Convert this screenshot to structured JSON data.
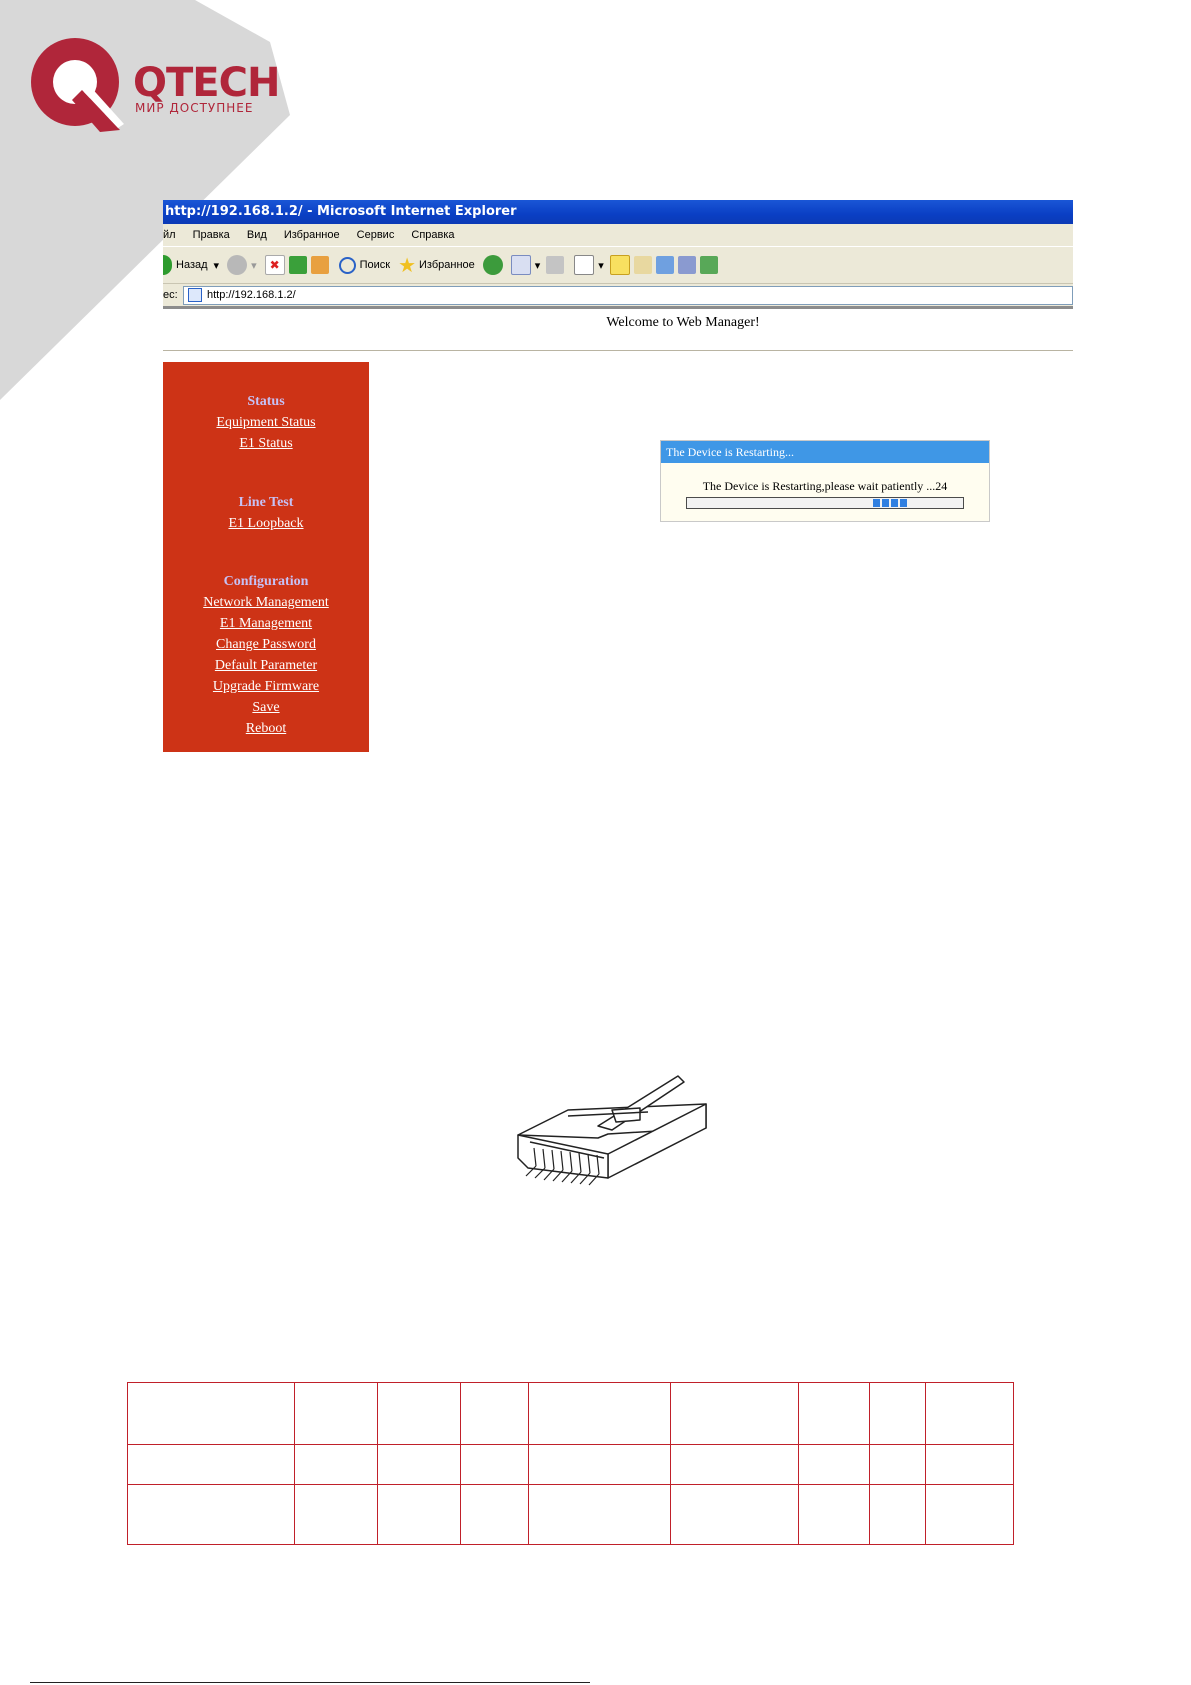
{
  "logo": {
    "brand": "QTECH",
    "tagline": "МИР ДОСТУПНЕЕ"
  },
  "browser": {
    "title": "http://192.168.1.2/ - Microsoft Internet Explorer",
    "menu": [
      "йл",
      "Правка",
      "Вид",
      "Избранное",
      "Сервис",
      "Справка"
    ],
    "toolbar": {
      "back": "Назад",
      "search": "Поиск",
      "favorites": "Избранное"
    },
    "address_label": "ес:",
    "address": "http://192.168.1.2/"
  },
  "page": {
    "welcome": "Welcome to Web Manager!",
    "sidebar": {
      "status_head": "Status",
      "status_links": [
        "Equipment Status",
        "E1 Status"
      ],
      "linetest_head": "Line Test",
      "linetest_links": [
        "E1 Loopback"
      ],
      "config_head": "Configuration",
      "config_links": [
        "Network Management",
        "E1 Management",
        "Change Password",
        "Default Parameter",
        "Upgrade Firmware",
        "Save",
        "Reboot"
      ]
    },
    "dialog": {
      "title": "The Device is Restarting...",
      "message": "The Device is Restarting,please wait patiently ...24"
    }
  },
  "colors": {
    "sidebar": "#cd3316",
    "titlebar": "#0a3fc4",
    "dialog_title": "#3f97e6",
    "brand": "#b0263a"
  }
}
